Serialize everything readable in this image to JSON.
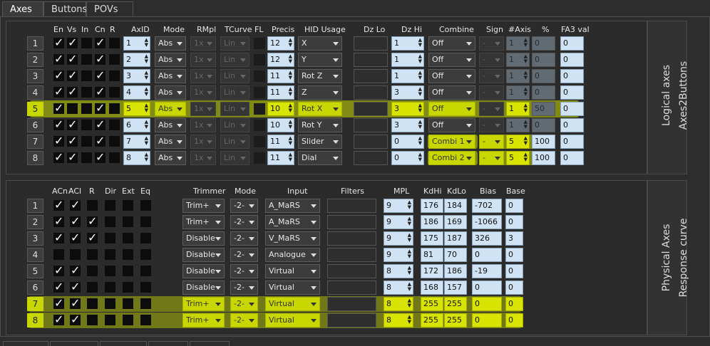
{
  "tabs": [
    "Axes",
    "Buttons",
    "POVs"
  ],
  "logical": {
    "side_title": "Logical axes",
    "side_subtitle": "Axes2Buttons",
    "headers": {
      "en": "En",
      "vs": "Vs",
      "in": "In",
      "cn": "Cn",
      "r": "R",
      "axid": "AxID",
      "mode": "Mode",
      "rmpl": "RMpl",
      "tcurve": "TCurve",
      "fl": "FL",
      "precis": "Precis",
      "hid": "HID Usage",
      "dzlo": "Dz Lo",
      "dzhi": "Dz Hi",
      "combine": "Combine",
      "sign": "Sign",
      "naxis": "#Axis",
      "pct": "%",
      "fa3": "FA3 val"
    },
    "rows": [
      {
        "n": "1",
        "en": true,
        "vs": true,
        "in": false,
        "cn": true,
        "r": false,
        "axid": "1",
        "mode": "Abs",
        "rmpl": "1x",
        "tcurve": "Lin",
        "precis": "12",
        "hid": "X",
        "dzhi": "1",
        "combine": "Off",
        "sign": "-",
        "naxis": "1",
        "pct": "0",
        "fa3": "0",
        "hl": false
      },
      {
        "n": "2",
        "en": true,
        "vs": true,
        "in": false,
        "cn": true,
        "r": false,
        "axid": "2",
        "mode": "Abs",
        "rmpl": "1x",
        "tcurve": "Lin",
        "precis": "12",
        "hid": "Y",
        "dzhi": "1",
        "combine": "Off",
        "sign": "-",
        "naxis": "1",
        "pct": "0",
        "fa3": "0",
        "hl": false
      },
      {
        "n": "3",
        "en": true,
        "vs": true,
        "in": false,
        "cn": true,
        "r": false,
        "axid": "3",
        "mode": "Abs",
        "rmpl": "1x",
        "tcurve": "Lin",
        "precis": "11",
        "hid": "Rot Z",
        "dzhi": "1",
        "combine": "Off",
        "sign": "-",
        "naxis": "1",
        "pct": "0",
        "fa3": "0",
        "hl": false
      },
      {
        "n": "4",
        "en": true,
        "vs": true,
        "in": false,
        "cn": true,
        "r": false,
        "axid": "4",
        "mode": "Abs",
        "rmpl": "1x",
        "tcurve": "Lin",
        "precis": "11",
        "hid": "Z",
        "dzhi": "3",
        "combine": "Off",
        "sign": "-",
        "naxis": "1",
        "pct": "0",
        "fa3": "0",
        "hl": false
      },
      {
        "n": "5",
        "en": true,
        "vs": false,
        "in": false,
        "cn": true,
        "r": false,
        "axid": "5",
        "mode": "Abs",
        "rmpl": "1x",
        "tcurve": "Lin",
        "precis": "10",
        "hid": "Rot X",
        "dzhi": "3",
        "combine": "Off",
        "sign": "-",
        "naxis": "1",
        "pct": "50",
        "fa3": "0",
        "hl": true
      },
      {
        "n": "6",
        "en": true,
        "vs": true,
        "in": false,
        "cn": true,
        "r": false,
        "axid": "6",
        "mode": "Abs",
        "rmpl": "1x",
        "tcurve": "Lin",
        "precis": "10",
        "hid": "Rot Y",
        "dzhi": "3",
        "combine": "Off",
        "sign": "-",
        "naxis": "1",
        "pct": "0",
        "fa3": "0",
        "hl": false
      },
      {
        "n": "7",
        "en": true,
        "vs": true,
        "in": false,
        "cn": true,
        "r": false,
        "axid": "7",
        "mode": "Abs",
        "rmpl": "1x",
        "tcurve": "Lin",
        "precis": "11",
        "hid": "Slider",
        "dzhi": "0",
        "combine": "Combi 1",
        "sign": "-",
        "naxis": "5",
        "pct": "100",
        "fa3": "0",
        "hl": "partial"
      },
      {
        "n": "8",
        "en": true,
        "vs": true,
        "in": false,
        "cn": true,
        "r": false,
        "axid": "8",
        "mode": "Abs",
        "rmpl": "1x",
        "tcurve": "Lin",
        "precis": "11",
        "hid": "Dial",
        "dzhi": "0",
        "combine": "Combi 2",
        "sign": "-",
        "naxis": "5",
        "pct": "100",
        "fa3": "0",
        "hl": "partial"
      }
    ]
  },
  "physical": {
    "side_title": "Physical Axes",
    "side_subtitle": "Response curve",
    "headers": {
      "acn": "ACn",
      "acl": "ACl",
      "r": "R",
      "dir": "Dir",
      "ext": "Ext",
      "eq": "Eq",
      "trimmer": "Trimmer",
      "mode": "Mode",
      "input": "Input",
      "filters": "Filters",
      "mpl": "MPL",
      "kdhi": "KdHi",
      "kdlo": "KdLo",
      "bias": "Bias",
      "base": "Base"
    },
    "rows": [
      {
        "n": "1",
        "acn": true,
        "acl": true,
        "r": false,
        "trimmer": "Trim+",
        "mode": "-2-",
        "input": "A_MaRS",
        "mpl": "9",
        "kdhi": "176",
        "kdlo": "184",
        "bias": "-702",
        "base": "0",
        "hl": false
      },
      {
        "n": "2",
        "acn": true,
        "acl": true,
        "r": true,
        "trimmer": "Trim+",
        "mode": "-2-",
        "input": "A_MaRS",
        "mpl": "9",
        "kdhi": "186",
        "kdlo": "169",
        "bias": "-1066",
        "base": "0",
        "hl": false
      },
      {
        "n": "3",
        "acn": true,
        "acl": true,
        "r": true,
        "trimmer": "Disable",
        "mode": "-2-",
        "input": "V_MaRS",
        "mpl": "9",
        "kdhi": "175",
        "kdlo": "187",
        "bias": "326",
        "base": "3",
        "hl": false
      },
      {
        "n": "4",
        "acn": false,
        "acl": false,
        "r": false,
        "trimmer": "Disable",
        "mode": "-2-",
        "input": "Analogue",
        "mpl": "9",
        "kdhi": "81",
        "kdlo": "70",
        "bias": "0",
        "base": "0",
        "hl": false
      },
      {
        "n": "5",
        "acn": true,
        "acl": true,
        "r": false,
        "trimmer": "Disable",
        "mode": "-2-",
        "input": "Virtual",
        "mpl": "8",
        "kdhi": "172",
        "kdlo": "186",
        "bias": "-19",
        "base": "0",
        "hl": false
      },
      {
        "n": "6",
        "acn": true,
        "acl": true,
        "r": false,
        "trimmer": "Disable",
        "mode": "-2-",
        "input": "Virtual",
        "mpl": "8",
        "kdhi": "168",
        "kdlo": "157",
        "bias": "0",
        "base": "0",
        "hl": false
      },
      {
        "n": "7",
        "acn": true,
        "acl": true,
        "r": false,
        "trimmer": "Trim+",
        "mode": "-2-",
        "input": "Virtual",
        "mpl": "8",
        "kdhi": "255",
        "kdlo": "255",
        "bias": "0",
        "base": "0",
        "hl": true
      },
      {
        "n": "8",
        "acn": true,
        "acl": true,
        "r": false,
        "trimmer": "Trim+",
        "mode": "-2-",
        "input": "Virtual",
        "mpl": "8",
        "kdhi": "255",
        "kdlo": "255",
        "bias": "0",
        "base": "0",
        "hl": true
      }
    ]
  },
  "colors": {
    "highlight": "#c8d800",
    "spin_bg": "#cfe3f4",
    "panel_bg": "#2b2b2b"
  }
}
